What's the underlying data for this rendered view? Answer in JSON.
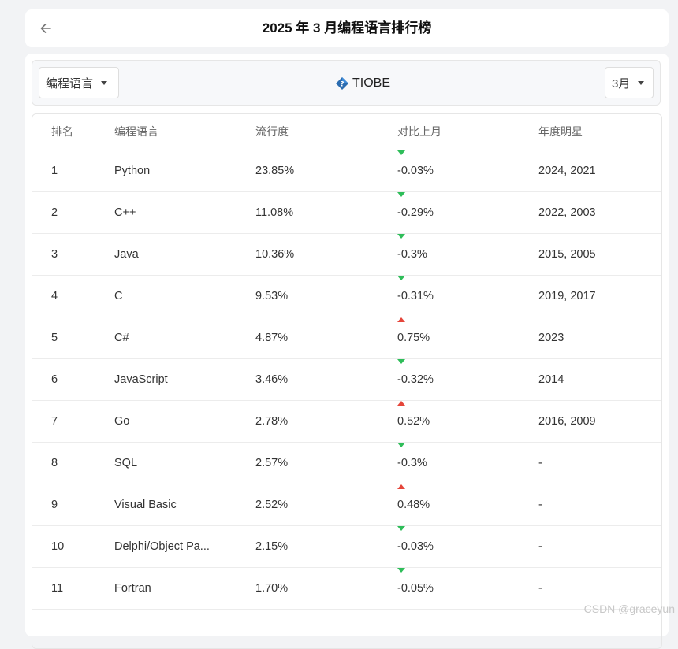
{
  "header": {
    "title": "2025 年 3 月编程语言排行榜"
  },
  "toolbar": {
    "category_select": "编程语言",
    "brand": "TIOBE",
    "month_select": "3月"
  },
  "table": {
    "columns": [
      "排名",
      "编程语言",
      "流行度",
      "对比上月",
      "年度明星"
    ],
    "rows": [
      {
        "rank": "1",
        "language": "Python",
        "popularity": "23.85%",
        "change": "-0.03%",
        "direction": "down",
        "star_years": "2024, 2021"
      },
      {
        "rank": "2",
        "language": "C++",
        "popularity": "11.08%",
        "change": "-0.29%",
        "direction": "down",
        "star_years": "2022, 2003"
      },
      {
        "rank": "3",
        "language": "Java",
        "popularity": "10.36%",
        "change": "-0.3%",
        "direction": "down",
        "star_years": "2015, 2005"
      },
      {
        "rank": "4",
        "language": "C",
        "popularity": "9.53%",
        "change": "-0.31%",
        "direction": "down",
        "star_years": "2019, 2017"
      },
      {
        "rank": "5",
        "language": "C#",
        "popularity": "4.87%",
        "change": "0.75%",
        "direction": "up",
        "star_years": "2023"
      },
      {
        "rank": "6",
        "language": "JavaScript",
        "popularity": "3.46%",
        "change": "-0.32%",
        "direction": "down",
        "star_years": "2014"
      },
      {
        "rank": "7",
        "language": "Go",
        "popularity": "2.78%",
        "change": "0.52%",
        "direction": "up",
        "star_years": "2016, 2009"
      },
      {
        "rank": "8",
        "language": "SQL",
        "popularity": "2.57%",
        "change": "-0.3%",
        "direction": "down",
        "star_years": "-"
      },
      {
        "rank": "9",
        "language": "Visual Basic",
        "popularity": "2.52%",
        "change": "0.48%",
        "direction": "up",
        "star_years": "-"
      },
      {
        "rank": "10",
        "language": "Delphi/Object Pa...",
        "popularity": "2.15%",
        "change": "-0.03%",
        "direction": "down",
        "star_years": "-"
      },
      {
        "rank": "11",
        "language": "Fortran",
        "popularity": "1.70%",
        "change": "-0.05%",
        "direction": "down",
        "star_years": "-"
      }
    ]
  },
  "colors": {
    "down": "#2ebd59",
    "up": "#e5453a",
    "brand_icon": "#2b6cb0"
  },
  "icons": {
    "back": "arrow-left-icon",
    "brand": "tiobe-diamond-icon",
    "dropdown": "caret-down-icon"
  },
  "watermark": "CSDN @graceyun"
}
